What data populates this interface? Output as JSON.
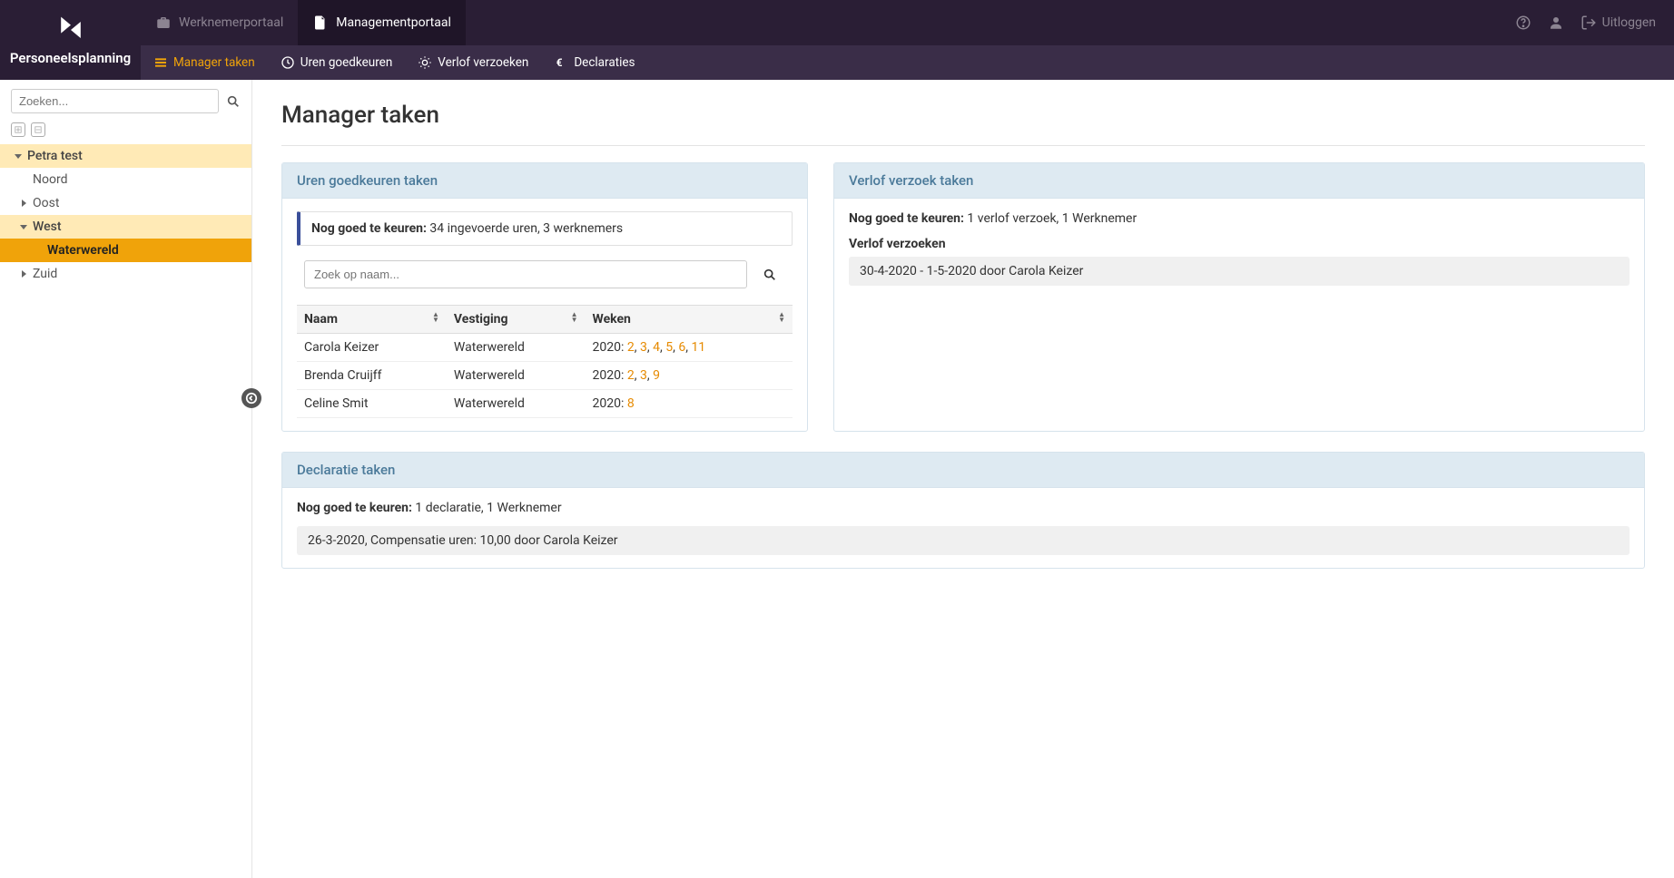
{
  "brand": {
    "name": "Personeelsplanning"
  },
  "portals": {
    "employee": "Werknemerportaal",
    "management": "Managementportaal"
  },
  "topright": {
    "logout": "Uitloggen"
  },
  "subnav": {
    "manager_taken": "Manager taken",
    "uren_goedkeuren": "Uren goedkeuren",
    "verlof_verzoeken": "Verlof verzoeken",
    "declaraties": "Declaraties"
  },
  "sidebar": {
    "search_placeholder": "Zoeken...",
    "tree": {
      "root": "Petra test",
      "noord": "Noord",
      "oost": "Oost",
      "west": "West",
      "waterwereld": "Waterwereld",
      "zuid": "Zuid"
    }
  },
  "page": {
    "title": "Manager taken"
  },
  "uren_panel": {
    "title": "Uren goedkeuren taken",
    "notice_label": "Nog goed te keuren:",
    "notice_text": " 34 ingevoerde uren, 3 werknemers",
    "search_placeholder": "Zoek op naam...",
    "col_naam": "Naam",
    "col_vestiging": "Vestiging",
    "col_weken": "Weken",
    "rows": [
      {
        "naam": "Carola Keizer",
        "vestiging": "Waterwereld",
        "year": "2020:",
        "weeks": [
          "2",
          "3",
          "4",
          "5",
          "6",
          "11"
        ]
      },
      {
        "naam": "Brenda Cruijff",
        "vestiging": "Waterwereld",
        "year": "2020:",
        "weeks": [
          "2",
          "3",
          "9"
        ]
      },
      {
        "naam": "Celine Smit",
        "vestiging": "Waterwereld",
        "year": "2020:",
        "weeks": [
          "8"
        ]
      }
    ]
  },
  "verlof_panel": {
    "title": "Verlof verzoek taken",
    "notice_label": "Nog goed te keuren:",
    "notice_text": " 1 verlof verzoek, 1 Werknemer",
    "sub_label": "Verlof verzoeken",
    "item": "30-4-2020 - 1-5-2020 door Carola Keizer"
  },
  "decl_panel": {
    "title": "Declaratie taken",
    "notice_label": "Nog goed te keuren:",
    "notice_text": " 1 declaratie, 1 Werknemer",
    "item": "26-3-2020, Compensatie uren: 10,00 door Carola Keizer"
  }
}
